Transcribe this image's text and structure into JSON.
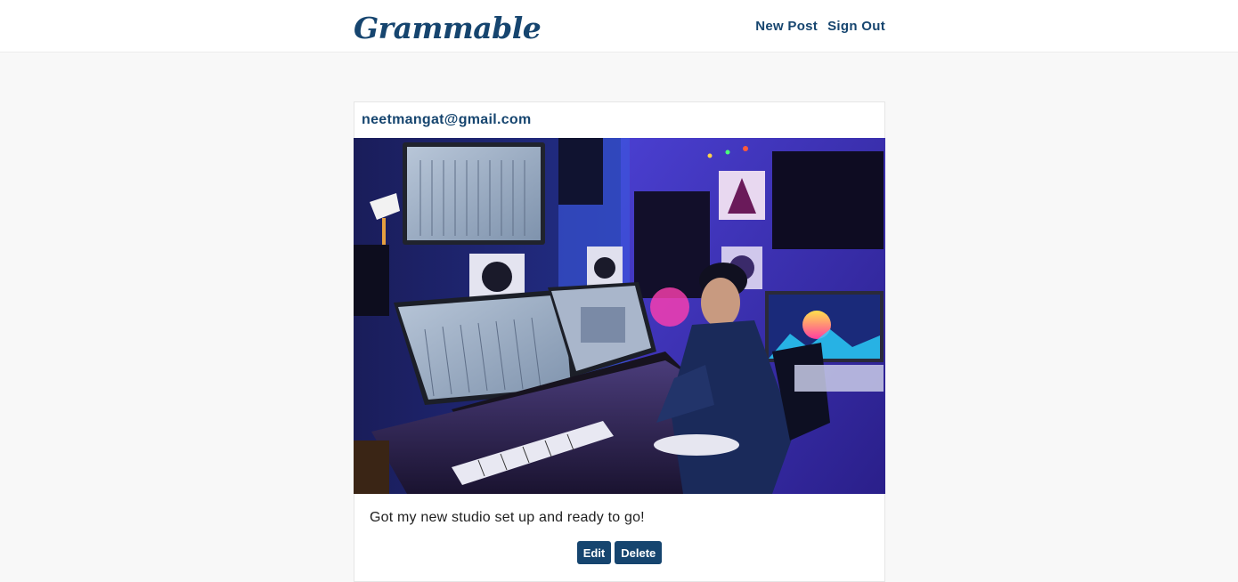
{
  "navbar": {
    "brand": "Grammable",
    "links": [
      {
        "label": "New Post"
      },
      {
        "label": "Sign Out"
      }
    ]
  },
  "post": {
    "author": "neetmangat@gmail.com",
    "photo_icon": "photo-studio-image",
    "caption": "Got my new studio set up and ready to go!",
    "actions": {
      "edit_label": "Edit",
      "delete_label": "Delete"
    }
  },
  "colors": {
    "brand": "#16456f",
    "background": "#f8f8f8",
    "card": "#ffffff"
  }
}
